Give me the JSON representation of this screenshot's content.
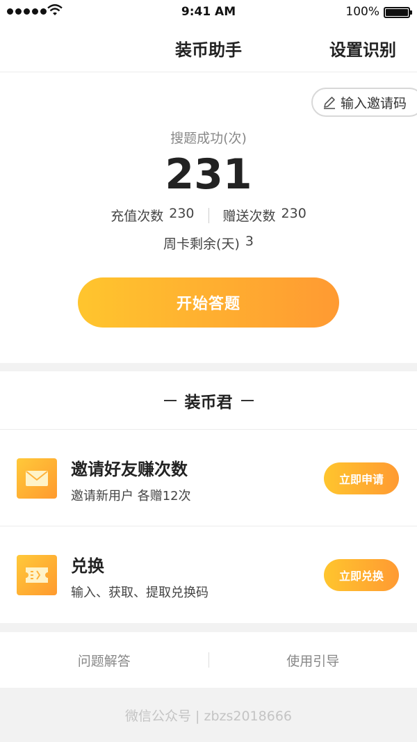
{
  "status_bar": {
    "time": "9:41 AM",
    "battery": "100%",
    "icons": [
      "signal-icon",
      "wifi-icon",
      "battery-icon"
    ]
  },
  "nav": {
    "title": "装币助手",
    "right_action": "设置识别"
  },
  "stats": {
    "invite_code_label": "输入邀请码",
    "label": "搜题成功(次)",
    "count": "231",
    "recharge_label": "充值次数",
    "recharge_value": "230",
    "gift_label": "赠送次数",
    "gift_value": "230",
    "week_label": "周卡剩余(天)",
    "week_value": "3",
    "start_button": "开始答题"
  },
  "section": {
    "title": "装币君",
    "features": [
      {
        "icon": "envelope-icon",
        "title": "邀请好友赚次数",
        "subtitle": "邀请新用户 各赠12次",
        "button": "立即申请"
      },
      {
        "icon": "ticket-icon",
        "title": "兑换",
        "subtitle": "输入、获取、提取兑换码",
        "button": "立即兑换"
      }
    ]
  },
  "tabs": [
    "问题解答",
    "使用引导"
  ],
  "footer": {
    "text": "微信公众号 | zbzs2018666"
  },
  "colors": {
    "accent_start": "#ffc52e",
    "accent_end": "#ff9a32",
    "background": "#f2f2f2"
  }
}
